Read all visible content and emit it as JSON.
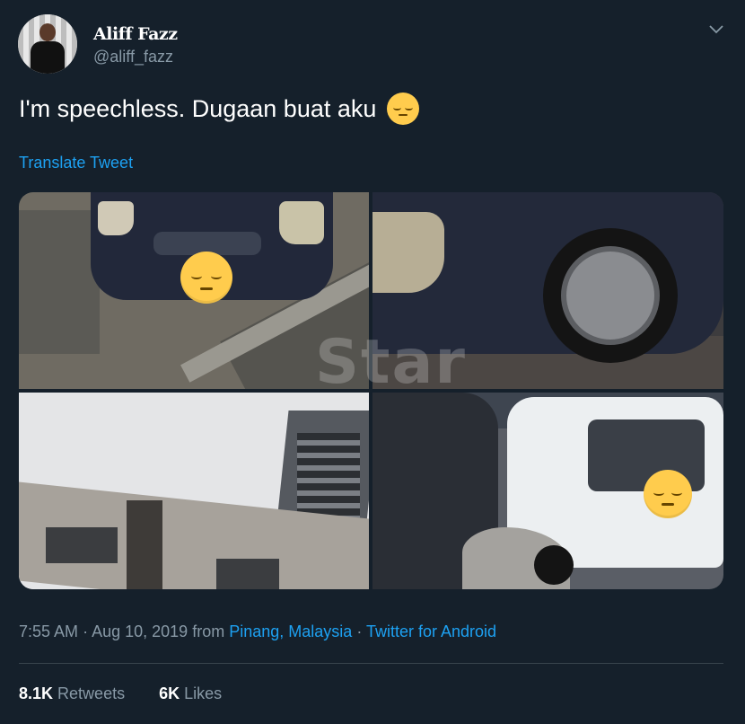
{
  "author": {
    "display_name": "Aliff Fazz",
    "handle": "@aliff_fazz"
  },
  "tweet": {
    "text": "I'm speechless. Dugaan buat aku",
    "emoji": "pensive-face",
    "translate_label": "Translate Tweet"
  },
  "media": {
    "watermark": "Star",
    "photos": [
      {
        "subject": "car-front-with-rubble",
        "censor_emoji": "pensive-face"
      },
      {
        "subject": "car-wheel-closeup"
      },
      {
        "subject": "building-looking-up"
      },
      {
        "subject": "white-car-crushed-by-rubble",
        "censor_emoji": "pensive-face"
      }
    ]
  },
  "meta": {
    "time": "7:55 AM",
    "separator": "·",
    "date": "Aug 10, 2019",
    "from_label": "from",
    "location": "Pinang, Malaysia",
    "client": "Twitter for Android"
  },
  "stats": {
    "retweets_count": "8.1K",
    "retweets_label": "Retweets",
    "likes_count": "6K",
    "likes_label": "Likes"
  },
  "colors": {
    "background": "#15202b",
    "link": "#1da1f2",
    "secondary_text": "#8899a6",
    "divider": "#38444d"
  },
  "icons": {
    "menu": "chevron-down-icon"
  }
}
